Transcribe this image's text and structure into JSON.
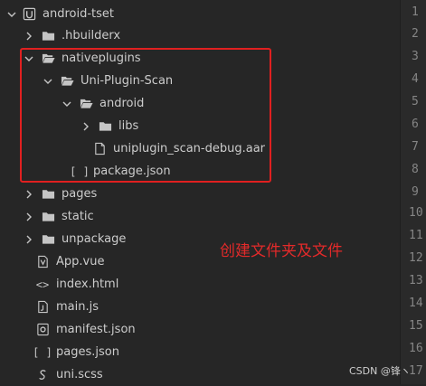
{
  "project": {
    "name": "android-tset"
  },
  "tree": [
    {
      "label": ".hbuilderx",
      "type": "folder"
    },
    {
      "label": "nativeplugins",
      "type": "folder-open"
    },
    {
      "label": "Uni-Plugin-Scan",
      "type": "folder-open"
    },
    {
      "label": "android",
      "type": "folder-open"
    },
    {
      "label": "libs",
      "type": "folder"
    },
    {
      "label": "uniplugin_scan-debug.aar",
      "type": "file"
    },
    {
      "label": "package.json",
      "type": "json"
    },
    {
      "label": "pages",
      "type": "folder"
    },
    {
      "label": "static",
      "type": "folder"
    },
    {
      "label": "unpackage",
      "type": "folder"
    },
    {
      "label": "App.vue",
      "type": "vue"
    },
    {
      "label": "index.html",
      "type": "html"
    },
    {
      "label": "main.js",
      "type": "js"
    },
    {
      "label": "manifest.json",
      "type": "manifest"
    },
    {
      "label": "pages.json",
      "type": "json"
    },
    {
      "label": "uni.scss",
      "type": "scss"
    }
  ],
  "line_numbers": [
    "1",
    "2",
    "3",
    "4",
    "5",
    "6",
    "7",
    "8",
    "9",
    "10",
    "11",
    "12",
    "13",
    "14",
    "15",
    "16",
    "17"
  ],
  "annotation": {
    "text": "创建文件夹及文件",
    "color": "#e32a2a"
  },
  "watermark": "CSDN @锋ヽ",
  "colors": {
    "background": "#252526",
    "highlight": "#e02020",
    "text": "#cccccc"
  }
}
